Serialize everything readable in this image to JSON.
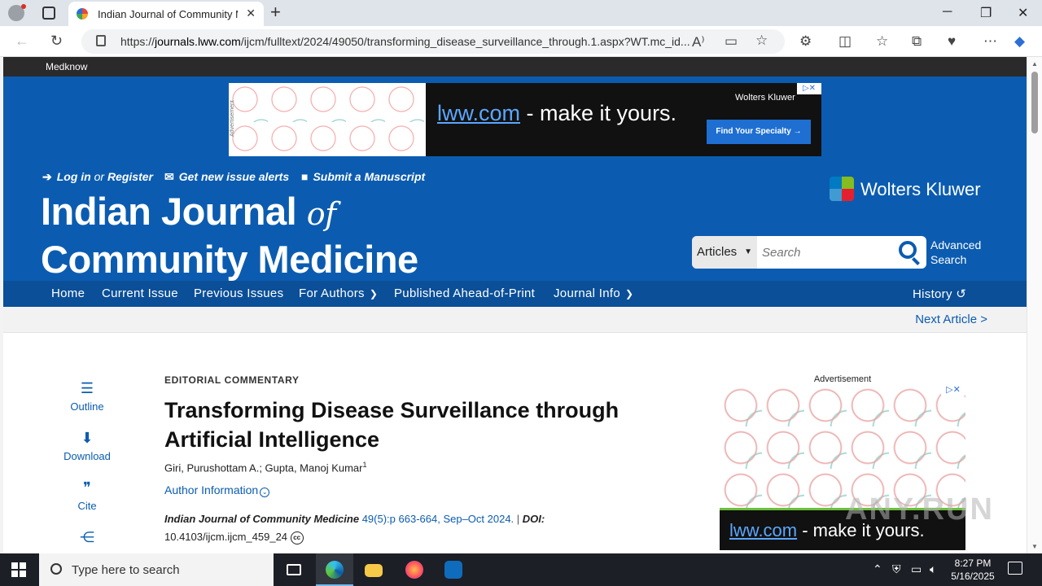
{
  "browser": {
    "tab_title": "Indian Journal of Community Me",
    "url_prefix": "https://",
    "url_host": "journals.lww.com",
    "url_path": "/ijcm/fulltext/2024/49050/transforming_disease_surveillance_through.1.aspx?WT.mc_id..."
  },
  "site": {
    "publisher_bar": "Medknow",
    "ad_top": {
      "label": "Advertisement",
      "lww": "lww.com",
      "slogan_rest": " - make it yours.",
      "brand": "Wolters Kluwer",
      "cta": "Find Your Specialty →",
      "close": "▷✕"
    },
    "top_links": {
      "login": "Log in",
      "or": "or",
      "register": "Register",
      "alerts": "Get new issue alerts",
      "submit": "Submit a Manuscript"
    },
    "journal_title_line1_a": "Indian Journal",
    "journal_title_line1_b": "of",
    "journal_title_line2": "Community Medicine",
    "wk_logo": "Wolters Kluwer",
    "search": {
      "scope": "Articles",
      "placeholder": "Search",
      "advanced": "Advanced Search"
    },
    "nav": {
      "home": "Home",
      "current": "Current Issue",
      "previous": "Previous Issues",
      "authors": "For Authors",
      "ahead": "Published Ahead-of-Print",
      "info": "Journal Info",
      "history": "History"
    },
    "next_article": "Next Article >"
  },
  "tools": {
    "outline": "Outline",
    "download": "Download",
    "cite": "Cite"
  },
  "article": {
    "kicker": "EDITORIAL COMMENTARY",
    "title": "Transforming Disease Surveillance through Artificial Intelligence",
    "authors": "Giri, Purushottam A.; Gupta, Manoj Kumar",
    "author_sup": "1",
    "author_info": "Author Information",
    "journal": "Indian Journal of Community Medicine",
    "volume": "49(5):p 663-664, Sep–Oct 2024.",
    "doi_label": "DOI:",
    "doi": "10.4103/ijcm.ijcm_459_24"
  },
  "side_ad": {
    "label": "Advertisement",
    "lww": "lww.com",
    "slogan_rest": " - make it yours.",
    "watermark": "ANY.RUN"
  },
  "taskbar": {
    "search_placeholder": "Type here to search",
    "time": "8:27 PM",
    "date": "5/16/2025"
  }
}
